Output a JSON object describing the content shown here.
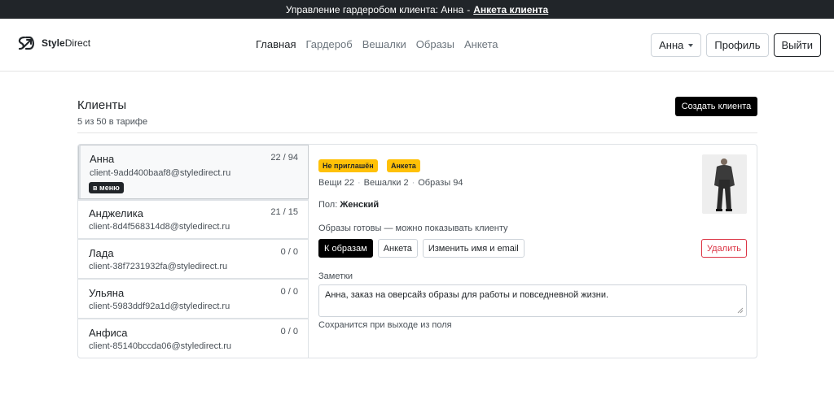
{
  "banner": {
    "text": "Управление гардеробом клиента: Анна",
    "separator": "-",
    "link": "Анкета клиента"
  },
  "navbar": {
    "brand_bold": "Style",
    "brand_rest": "Direct",
    "links": [
      {
        "label": "Главная",
        "active": true
      },
      {
        "label": "Гардероб"
      },
      {
        "label": "Вешалки"
      },
      {
        "label": "Образы"
      },
      {
        "label": "Анкета"
      }
    ],
    "user_dropdown": "Анна",
    "profile_button": "Профиль",
    "logout_button": "Выйти"
  },
  "page": {
    "title": "Клиенты",
    "subtitle": "5 из 50 в тарифе",
    "create_button": "Создать клиента"
  },
  "clients": [
    {
      "name": "Анна",
      "email": "client-9add400baaf8@styledirect.ru",
      "count": "22 / 94",
      "badge": "в меню",
      "selected": true
    },
    {
      "name": "Анджелика",
      "email": "client-8d4f568314d8@styledirect.ru",
      "count": "21 / 15"
    },
    {
      "name": "Лада",
      "email": "client-38f7231932fa@styledirect.ru",
      "count": "0 / 0"
    },
    {
      "name": "Ульяна",
      "email": "client-5983ddf92a1d@styledirect.ru",
      "count": "0 / 0"
    },
    {
      "name": "Анфиса",
      "email": "client-85140bccda06@styledirect.ru",
      "count": "0 / 0"
    }
  ],
  "detail": {
    "badges": [
      "Не приглашён",
      "Анкета"
    ],
    "stats": [
      "Вещи 22",
      "Вешалки 2",
      "Образы 94"
    ],
    "stats_separator": "·",
    "gender_label": "Пол:",
    "gender_value": "Женский",
    "ready_text": "Образы готовы — можно показывать клиенту",
    "buttons": {
      "to_looks": "К образам",
      "survey": "Анкета",
      "edit": "Изменить имя и email",
      "delete": "Удалить"
    },
    "notes_label": "Заметки",
    "notes_text": "Анна, заказ на оверсайз образы для работы и повседневной жизни.",
    "notes_hint": "Сохранится при выходе из поля"
  },
  "colors": {
    "banner_bg": "#212529",
    "badge_yellow": "#ffc107",
    "danger": "#dc3545",
    "primary_button": "#000000"
  }
}
